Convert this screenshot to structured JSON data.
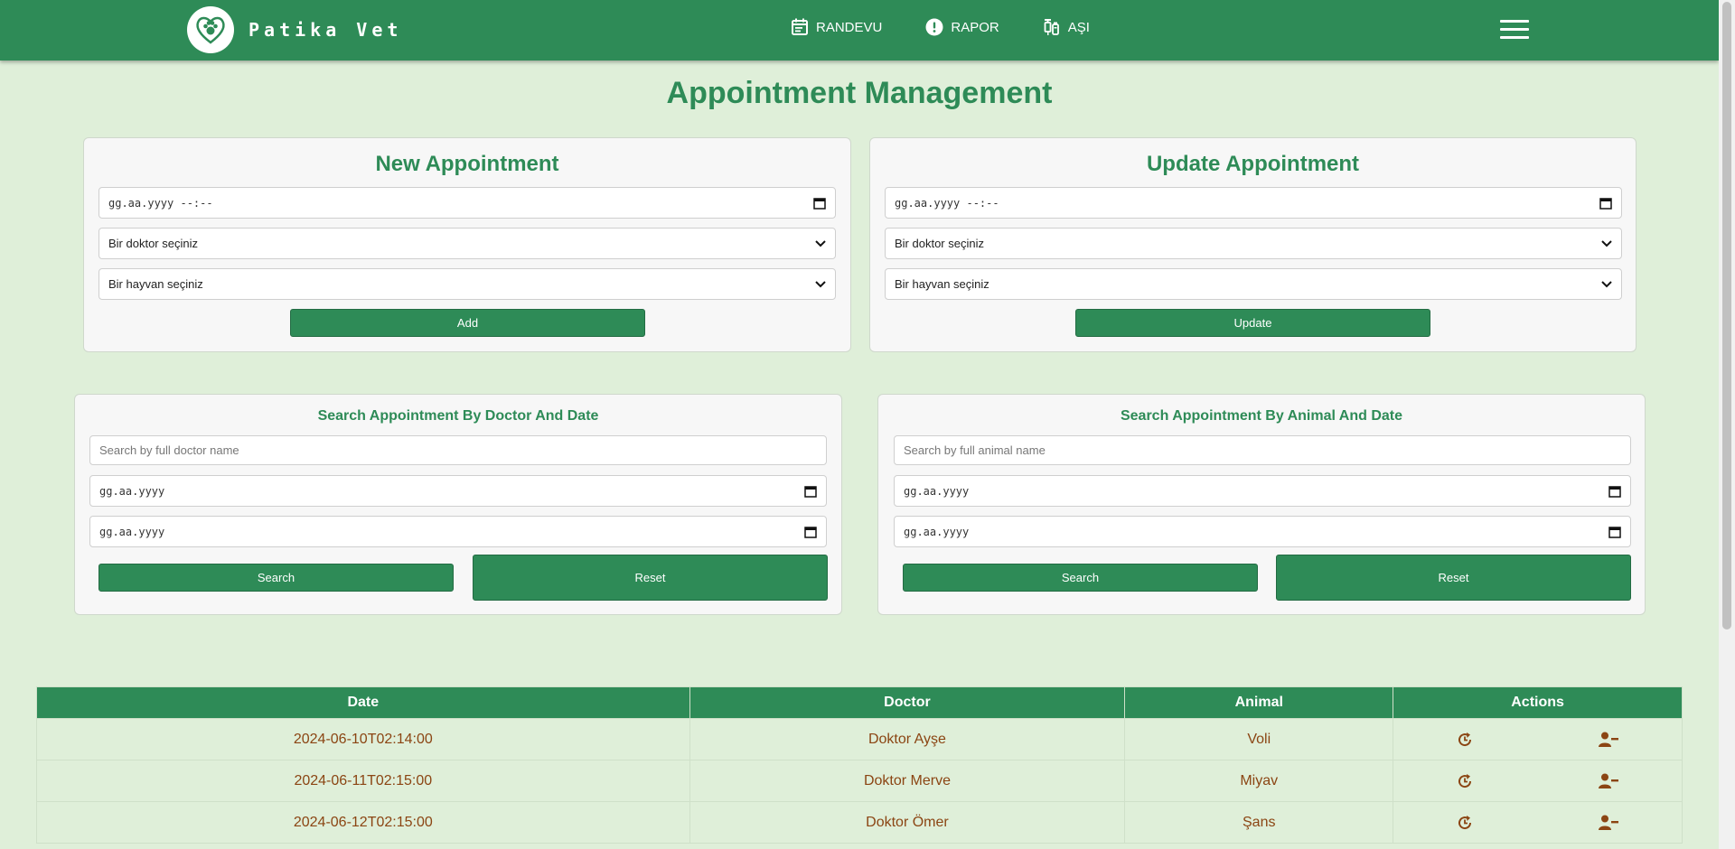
{
  "brand": {
    "name": "Patika Vet"
  },
  "nav": [
    {
      "label": "RANDEVU",
      "icon": "calendar-icon"
    },
    {
      "label": "RAPOR",
      "icon": "alert-icon"
    },
    {
      "label": "AŞI",
      "icon": "syringe-icon"
    }
  ],
  "page_title": "Appointment Management",
  "new_appointment": {
    "title": "New Appointment",
    "datetime_placeholder": "gg.aa.yyyy --:--",
    "doctor_select": "Bir doktor seçiniz",
    "animal_select": "Bir hayvan seçiniz",
    "button": "Add"
  },
  "update_appointment": {
    "title": "Update Appointment",
    "datetime_placeholder": "gg.aa.yyyy --:--",
    "doctor_select": "Bir doktor seçiniz",
    "animal_select": "Bir hayvan seçiniz",
    "button": "Update"
  },
  "search_doctor": {
    "title": "Search Appointment By Doctor And Date",
    "name_placeholder": "Search by full doctor name",
    "start_date": "gg.aa.yyyy",
    "end_date": "gg.aa.yyyy",
    "search_button": "Search",
    "reset_button": "Reset"
  },
  "search_animal": {
    "title": "Search Appointment By Animal And Date",
    "name_placeholder": "Search by full animal name",
    "start_date": "gg.aa.yyyy",
    "end_date": "gg.aa.yyyy",
    "search_button": "Search",
    "reset_button": "Reset"
  },
  "table": {
    "headers": [
      "Date",
      "Doctor",
      "Animal",
      "Actions"
    ],
    "rows": [
      {
        "date": "2024-06-10T02:14:00",
        "doctor": "Doktor Ayşe",
        "animal": "Voli"
      },
      {
        "date": "2024-06-11T02:15:00",
        "doctor": "Doktor Merve",
        "animal": "Miyav"
      },
      {
        "date": "2024-06-12T02:15:00",
        "doctor": "Doktor Ömer",
        "animal": "Şans"
      }
    ]
  },
  "colors": {
    "primary": "#2e8b57",
    "background": "#dfefd9",
    "table_text": "#8b4513"
  }
}
